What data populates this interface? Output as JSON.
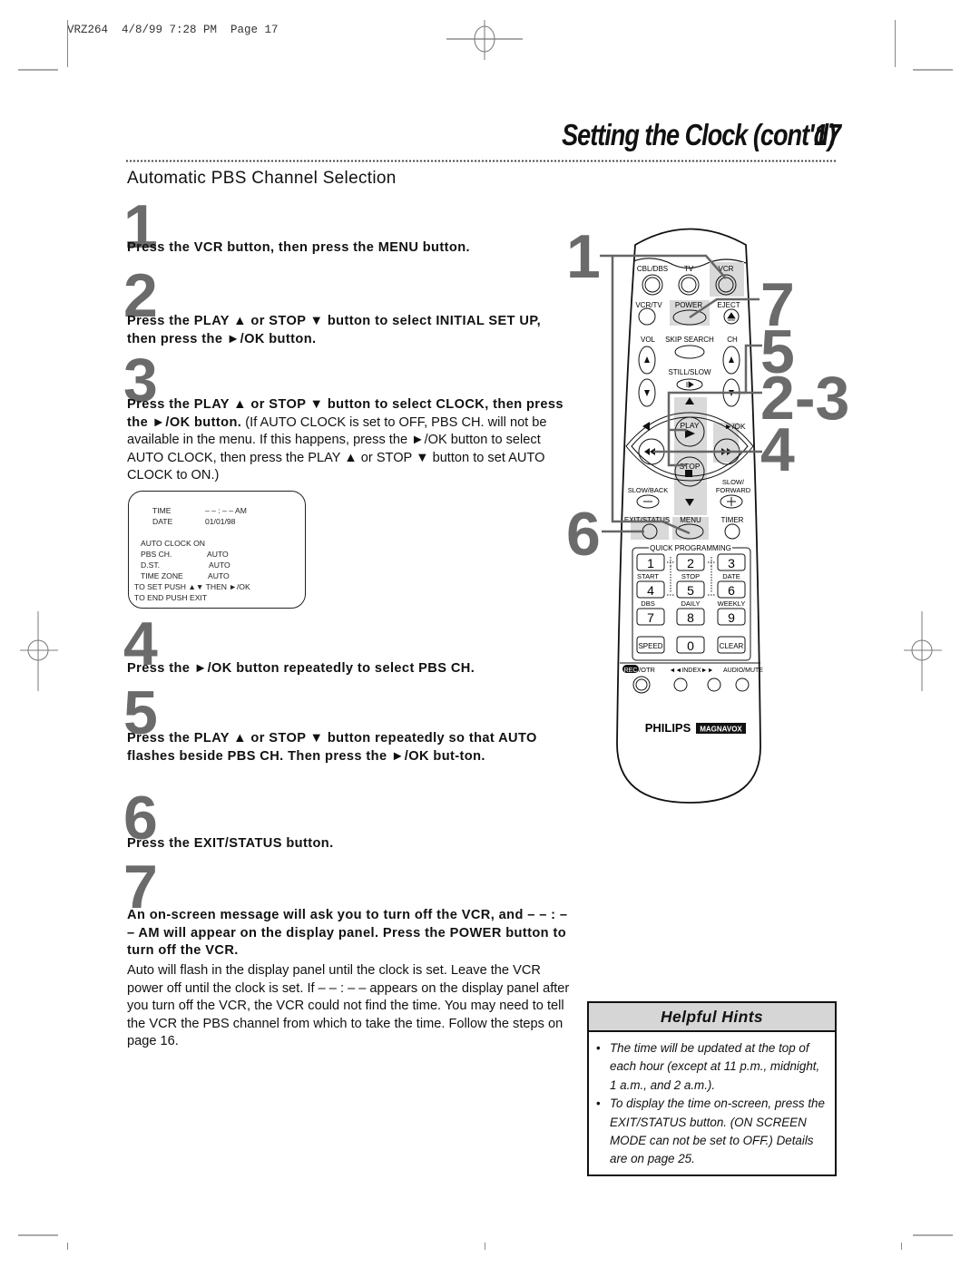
{
  "slug": "VRZ264  4/8/99 7:28 PM  Page 17",
  "header": {
    "title": "Setting the Clock (cont'd)",
    "page_number": "17"
  },
  "section_title": "Automatic PBS Channel Selection",
  "steps": [
    {
      "number": "1",
      "bold": "Press the VCR button, then press the MENU button.",
      "normal": ""
    },
    {
      "number": "2",
      "bold": "Press the PLAY ▲ or STOP ▼ button to select INITIAL SET UP, then press the ►/OK button.",
      "normal": ""
    },
    {
      "number": "3",
      "bold": "Press the PLAY ▲ or STOP ▼ button to select CLOCK, then press the ►/OK button.",
      "normal": " (If AUTO CLOCK is set to OFF, PBS CH. will not be available in the menu. If this happens, press the ►/OK button to select AUTO CLOCK, then press the PLAY ▲ or STOP ▼ button to set AUTO CLOCK to ON.)"
    },
    {
      "number": "4",
      "bold": "Press the ►/OK button repeatedly to select PBS CH.",
      "normal": ""
    },
    {
      "number": "5",
      "bold": "Press the PLAY ▲ or STOP ▼ button repeatedly so that AUTO flashes beside PBS CH. Then press the ►/OK but-ton.",
      "normal": ""
    },
    {
      "number": "6",
      "bold": "Press the EXIT/STATUS button.",
      "normal": ""
    },
    {
      "number": "7",
      "bold": "An on-screen message will ask you to turn off the VCR, and – – : – – AM will appear on the display panel. Press the POWER button to turn off the VCR.",
      "normal": "Auto will flash in the display panel until the clock is set. Leave the VCR power off until the clock is set. If – – : – – appears on the display panel after you turn off the VCR, the VCR could not find the time. You may need to tell the VCR the PBS channel from which to take the time. Follow the steps on page 16."
    }
  ],
  "onscreen_menu": {
    "time_label": "TIME",
    "time_value": "– – : – – AM",
    "date_label": "DATE",
    "date_value": "01/01/98",
    "auto_clock": "AUTO CLOCK ON",
    "pbs_label": "PBS CH.",
    "pbs_value": "AUTO",
    "dst_label": "D.ST.",
    "dst_value": "AUTO",
    "tz_label": "TIME ZONE",
    "tz_value": "AUTO",
    "hint1": "TO SET PUSH ▲▼ THEN ►/OK",
    "hint2": "TO END PUSH EXIT"
  },
  "helpful_hints": {
    "title": "Helpful Hints",
    "items": [
      "The time will be updated at the top of each hour (except at 11 p.m., midnight, 1 a.m., and 2 a.m.).",
      "To display the time on-screen, press the EXIT/STATUS button. (ON SCREEN MODE can not be set to OFF.) Details are on page 25."
    ]
  },
  "remote": {
    "callouts": [
      "1",
      "7",
      "5",
      "2-3",
      "4",
      "6"
    ],
    "labels": {
      "cbl_dbs": "CBL/DBS",
      "tv": "TV",
      "vcr": "VCR",
      "vcr_tv": "VCR/TV",
      "power": "POWER",
      "eject": "EJECT",
      "vol": "VOL",
      "skip_search": "SKIP SEARCH",
      "ch": "CH",
      "still_slow": "STILL/SLOW",
      "play": "PLAY",
      "ok": "►/OK",
      "stop": "STOP",
      "slow_back": "SLOW/BACK",
      "slow_forward_1": "SLOW/",
      "slow_forward_2": "FORWARD",
      "exit_status": "EXIT/STATUS",
      "menu": "MENU",
      "timer": "TIMER",
      "quick_programming": "QUICK PROGRAMMING",
      "start": "START",
      "stop_sub": "STOP",
      "date": "DATE",
      "dbs": "DBS",
      "daily": "DAILY",
      "weekly": "WEEKLY",
      "speed": "SPEED",
      "clear": "CLEAR",
      "rec": "REC",
      "otr": "/OTR",
      "index": "◄◄INDEX►►",
      "audio_mute": "AUDIO/MUTE",
      "brand1": "PHILIPS",
      "brand2": "MAGNAVOX"
    },
    "keypad": [
      "1",
      "2",
      "3",
      "4",
      "5",
      "6",
      "7",
      "8",
      "9",
      "0"
    ]
  },
  "colors": {
    "step_number": "#6b6b6b",
    "highlight": "#d9d9d9",
    "hints_header": "#d6d6d6"
  }
}
